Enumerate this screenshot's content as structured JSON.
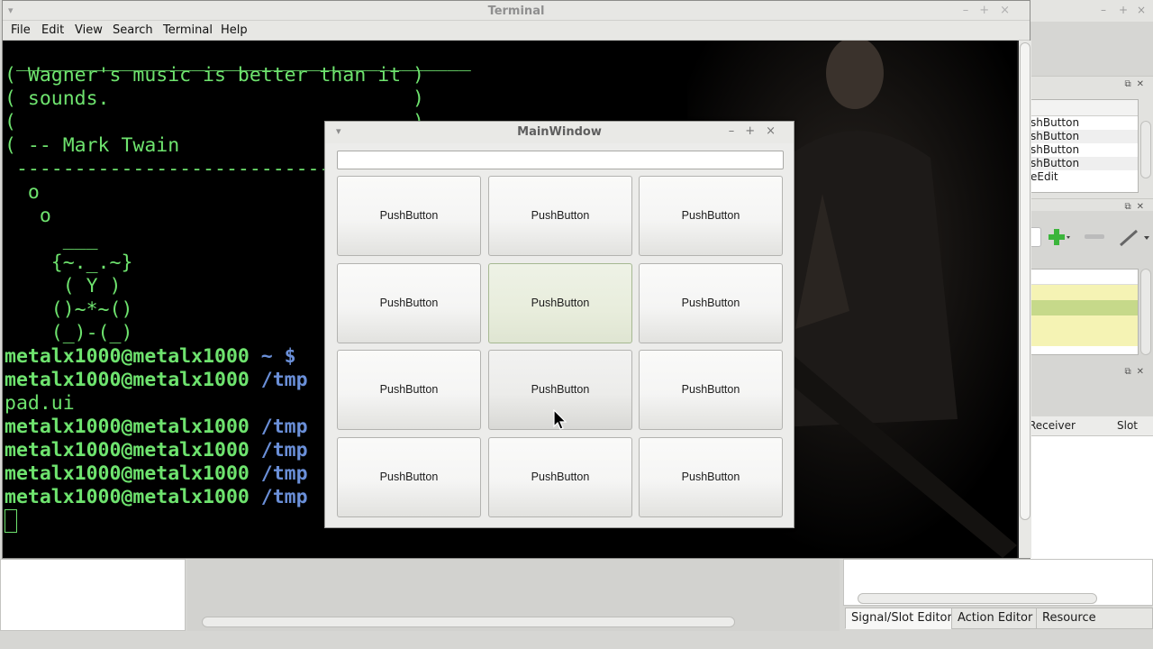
{
  "terminal": {
    "title": "Terminal",
    "menu": [
      "File",
      "Edit",
      "View",
      "Search",
      "Terminal",
      "Help"
    ],
    "lines": [
      " _______________________________________",
      "( Wagner's music is better than it )",
      "( sounds.                          )",
      "(                                  )",
      "( -- Mark Twain",
      " -----------------------------------",
      "  o",
      "   o",
      "     ___",
      "    {~._.~}",
      "     ( Y )",
      "    ()~*~()",
      "    (_)-(_)"
    ],
    "prompts": [
      {
        "user": "metalx1000@metalx1000",
        "path": " ~ $",
        "rest": ""
      },
      {
        "user": "metalx1000@metalx1000",
        "path": " /tmp",
        "rest": ""
      },
      {
        "user": "pad.ui",
        "path": "",
        "rest": ""
      },
      {
        "user": "metalx1000@metalx1000",
        "path": " /tmp",
        "rest": ""
      },
      {
        "user": "metalx1000@metalx1000",
        "path": " /tmp",
        "rest": ""
      },
      {
        "user": "metalx1000@metalx1000",
        "path": " /tmp",
        "rest": ""
      },
      {
        "user": "metalx1000@metalx1000",
        "path": " /tmp",
        "rest": ""
      }
    ]
  },
  "main_window": {
    "title": "MainWindow",
    "line_edit_value": "",
    "buttons": [
      "PushButton",
      "PushButton",
      "PushButton",
      "PushButton",
      "PushButton",
      "PushButton",
      "PushButton",
      "PushButton",
      "PushButton",
      "PushButton",
      "PushButton",
      "PushButton"
    ]
  },
  "designer": {
    "object_inspector": [
      "shButton",
      "shButton",
      "shButton",
      "shButton",
      "eEdit"
    ],
    "signal_slot_headers": {
      "receiver": "Receiver",
      "slot": "Slot"
    },
    "bottom_tabs": [
      "Signal/Slot Editor",
      "Action Editor",
      "Resource Browser"
    ],
    "active_tab": "Signal/Slot Editor"
  },
  "colors": {
    "terminal_text": "#6ee36e",
    "terminal_path": "#6a8fd8",
    "property_highlight_light": "#f5f3b4",
    "property_highlight_dark": "#c6d98a"
  }
}
